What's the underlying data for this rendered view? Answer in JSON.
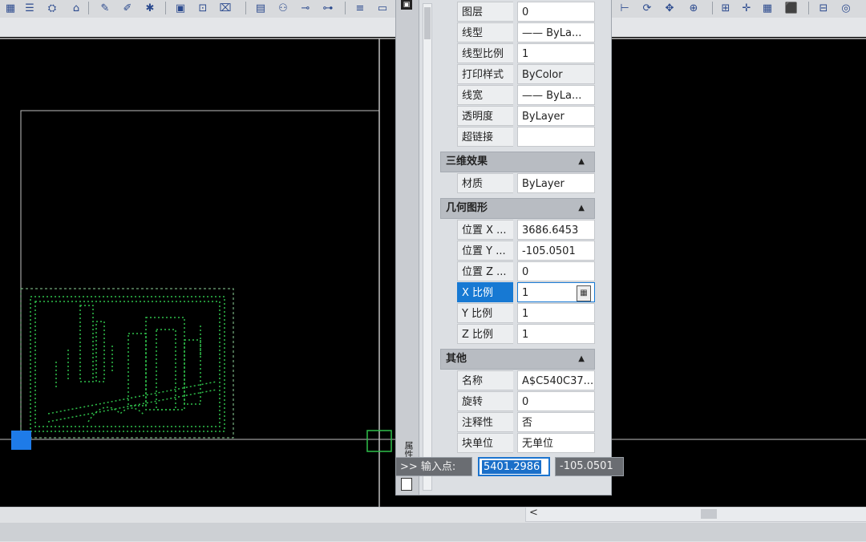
{
  "toolbar": {
    "icons": [
      "layer-properties-icon",
      "layer-state-icon",
      "match-layer-icon",
      "layer-isolate-icon",
      "paint-icon",
      "edit-icon",
      "explode-icon",
      "insert-block-icon",
      "define-attribute-icon",
      "hatch-icon",
      "table-icon",
      "group-icon",
      "measure-icon",
      "distance-icon",
      "text-style-icon",
      "dim-style-icon",
      "dimension-icon",
      "orbit-icon",
      "pan-icon",
      "zoom-icon",
      "snap-icon",
      "move-icon",
      "grid-icon",
      "lock-icon",
      "view-icon",
      "navigate-icon"
    ]
  },
  "properties": {
    "general_rows": [
      {
        "label": "图层",
        "value": "0"
      },
      {
        "label": "线型",
        "value": "—— ByLa..."
      },
      {
        "label": "线型比例",
        "value": "1"
      },
      {
        "label": "打印样式",
        "value": "ByColor"
      },
      {
        "label": "线宽",
        "value": "—— ByLa..."
      },
      {
        "label": "透明度",
        "value": "ByLayer"
      },
      {
        "label": "超链接",
        "value": ""
      }
    ],
    "section_3d": "三维效果",
    "material": {
      "label": "材质",
      "value": "ByLayer"
    },
    "section_geometry": "几何图形",
    "geometry_rows": [
      {
        "label": "位置 X ...",
        "value": "3686.6453"
      },
      {
        "label": "位置 Y ...",
        "value": "-105.0501"
      },
      {
        "label": "位置 Z ...",
        "value": "0"
      },
      {
        "label": "X 比例",
        "value": "1"
      },
      {
        "label": "Y 比例",
        "value": "1"
      },
      {
        "label": "Z 比例",
        "value": "1"
      }
    ],
    "section_misc": "其他",
    "misc_rows": [
      {
        "label": "名称",
        "value": "A$C540C37..."
      },
      {
        "label": "旋转",
        "value": "0"
      },
      {
        "label": "注释性",
        "value": "否"
      },
      {
        "label": "块单位",
        "value": "无单位"
      }
    ],
    "side_title": "属性"
  },
  "command": {
    "prompt": ">> 输入点:",
    "x_value": "5401.2986",
    "y_value": "-105.0501"
  },
  "colors": {
    "canvas": "#000000",
    "selection": "#1779d3",
    "block_lines": "#2fbf4a",
    "grip": "#1e7be8"
  }
}
